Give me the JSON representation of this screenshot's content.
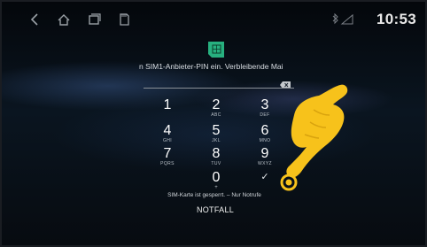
{
  "statusbar": {
    "nav_icons": [
      "back-icon",
      "home-icon",
      "recents-icon",
      "sd-card-icon"
    ],
    "status_icons": [
      "bluetooth-icon",
      "signal-icon"
    ],
    "time": "10:53"
  },
  "lock_screen": {
    "sim_icon": "sim-card-icon",
    "prompt": "n SIM1-Anbieter-PIN ein. Verbleibende Mai",
    "pin_value": "",
    "backspace_icon": "backspace-icon",
    "keypad": [
      {
        "num": "1",
        "letters": ""
      },
      {
        "num": "2",
        "letters": "ABC"
      },
      {
        "num": "3",
        "letters": "DEF"
      },
      {
        "num": "4",
        "letters": "GHI"
      },
      {
        "num": "5",
        "letters": "JKL"
      },
      {
        "num": "6",
        "letters": "MNO"
      },
      {
        "num": "7",
        "letters": "PQRS"
      },
      {
        "num": "8",
        "letters": "TUV"
      },
      {
        "num": "9",
        "letters": "WXYZ"
      },
      {
        "num": "0",
        "letters": "+"
      },
      {
        "num": "✓",
        "letters": ""
      }
    ],
    "sim_locked_text": "SIM-Karte ist gesperrt. – Nur Notrufe",
    "emergency_label": "NOTFALL"
  },
  "overlay": {
    "hand_icon": "pointing-hand-icon",
    "hand_color": "#f7c21b"
  }
}
